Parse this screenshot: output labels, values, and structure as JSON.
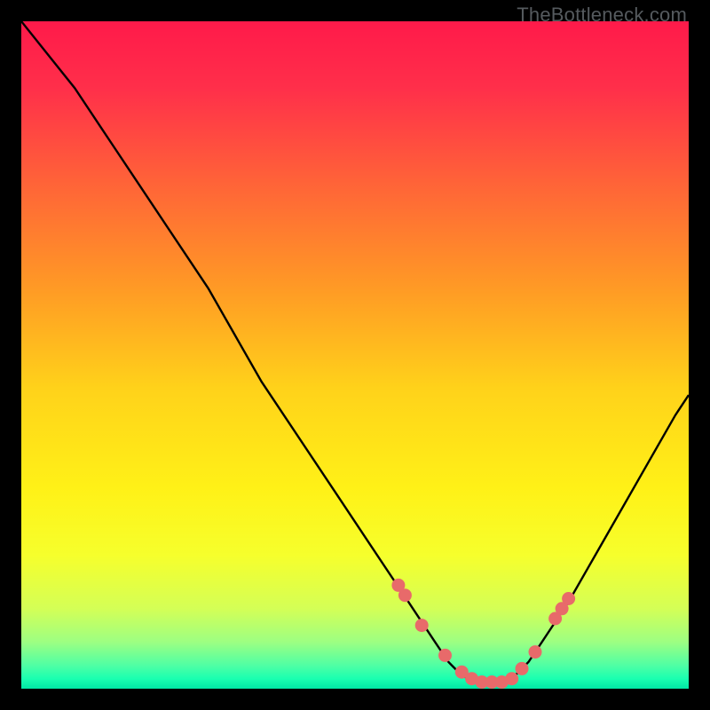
{
  "watermark": "TheBottleneck.com",
  "colors": {
    "frame": "#000000",
    "curve": "#000000",
    "dot": "#e86a6a",
    "gradient_stops": [
      {
        "offset": 0.0,
        "color": "#ff1a4a"
      },
      {
        "offset": 0.1,
        "color": "#ff2f4a"
      },
      {
        "offset": 0.25,
        "color": "#ff6637"
      },
      {
        "offset": 0.4,
        "color": "#ff9a25"
      },
      {
        "offset": 0.55,
        "color": "#ffd21a"
      },
      {
        "offset": 0.7,
        "color": "#fff117"
      },
      {
        "offset": 0.8,
        "color": "#f6ff2c"
      },
      {
        "offset": 0.88,
        "color": "#d4ff56"
      },
      {
        "offset": 0.93,
        "color": "#9dff82"
      },
      {
        "offset": 0.965,
        "color": "#4fffa4"
      },
      {
        "offset": 0.985,
        "color": "#1affb0"
      },
      {
        "offset": 1.0,
        "color": "#00e7a5"
      }
    ]
  },
  "chart_data": {
    "type": "line",
    "title": "",
    "xlabel": "",
    "ylabel": "",
    "xlim": [
      0,
      100
    ],
    "ylim": [
      0,
      100
    ],
    "series": [
      {
        "name": "bottleneck-curve",
        "x": [
          0,
          4,
          8,
          12,
          16,
          20,
          24,
          28,
          32,
          36,
          40,
          44,
          48,
          52,
          56,
          58,
          60,
          62,
          64,
          66,
          68,
          70,
          72,
          74,
          76,
          78,
          82,
          86,
          90,
          94,
          98,
          100
        ],
        "y": [
          100,
          95,
          90,
          84,
          78,
          72,
          66,
          60,
          53,
          46,
          40,
          34,
          28,
          22,
          16,
          13,
          10,
          7,
          4,
          2,
          1,
          1,
          1,
          2,
          4,
          7,
          13,
          20,
          27,
          34,
          41,
          44
        ]
      }
    ],
    "annotations": [],
    "dots": {
      "name": "highlight-dots",
      "x": [
        56.5,
        57.5,
        60.0,
        63.5,
        66.0,
        67.5,
        69.0,
        70.5,
        72.0,
        73.5,
        75.0,
        77.0,
        80.0,
        81.0,
        82.0
      ],
      "y": [
        15.5,
        14.0,
        9.5,
        5.0,
        2.5,
        1.5,
        1.0,
        1.0,
        1.0,
        1.5,
        3.0,
        5.5,
        10.5,
        12.0,
        13.5
      ]
    }
  }
}
